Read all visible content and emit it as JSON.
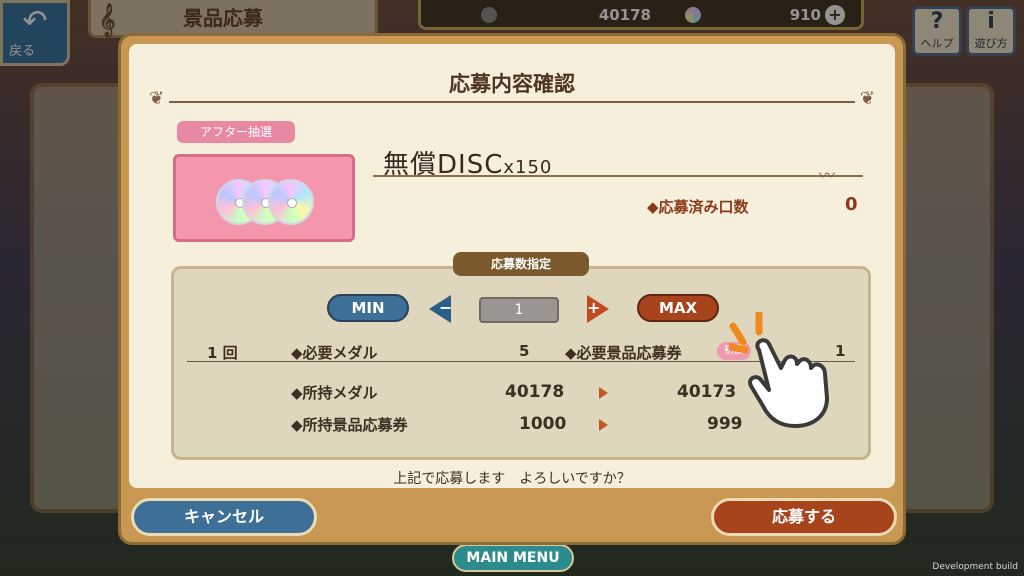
{
  "background": {
    "back_label": "戻る",
    "screen_title": "景品応募",
    "medal_count": "40178",
    "disc_count": "910",
    "help_glyph": "?",
    "help_label": "ヘルプ",
    "howto_glyph": "i",
    "howto_label": "遊び方",
    "main_menu": "MAIN MENU",
    "watermark": "Development build"
  },
  "dialog": {
    "title": "応募内容確認",
    "category_tag": "アフター抽選",
    "prize_name": "無償DISC",
    "prize_qty": "x150",
    "applied_label": "◆応募済み口数",
    "applied_value": "0",
    "count_tag": "応募数指定",
    "min_label": "MIN",
    "max_label": "MAX",
    "quantity": "1",
    "times_label": "1 回",
    "req_medal_label": "◆必要メダル",
    "req_medal_value": "5",
    "req_ticket_label": "◆必要景品応募券",
    "req_ticket_badge": "初回",
    "req_ticket_value": "1",
    "own_medal_label": "◆所持メダル",
    "own_medal_before": "40178",
    "own_medal_after": "40173",
    "own_ticket_label": "◆所持景品応募券",
    "own_ticket_before": "1000",
    "own_ticket_after": "999",
    "confirm_text": "上記で応募します　よろしいですか？",
    "cancel_label": "キャンセル",
    "apply_label": "応募する"
  },
  "colors": {
    "accent_blue": "#3e6f96",
    "accent_red": "#a8441b",
    "panel_bg": "#f6efdc"
  }
}
